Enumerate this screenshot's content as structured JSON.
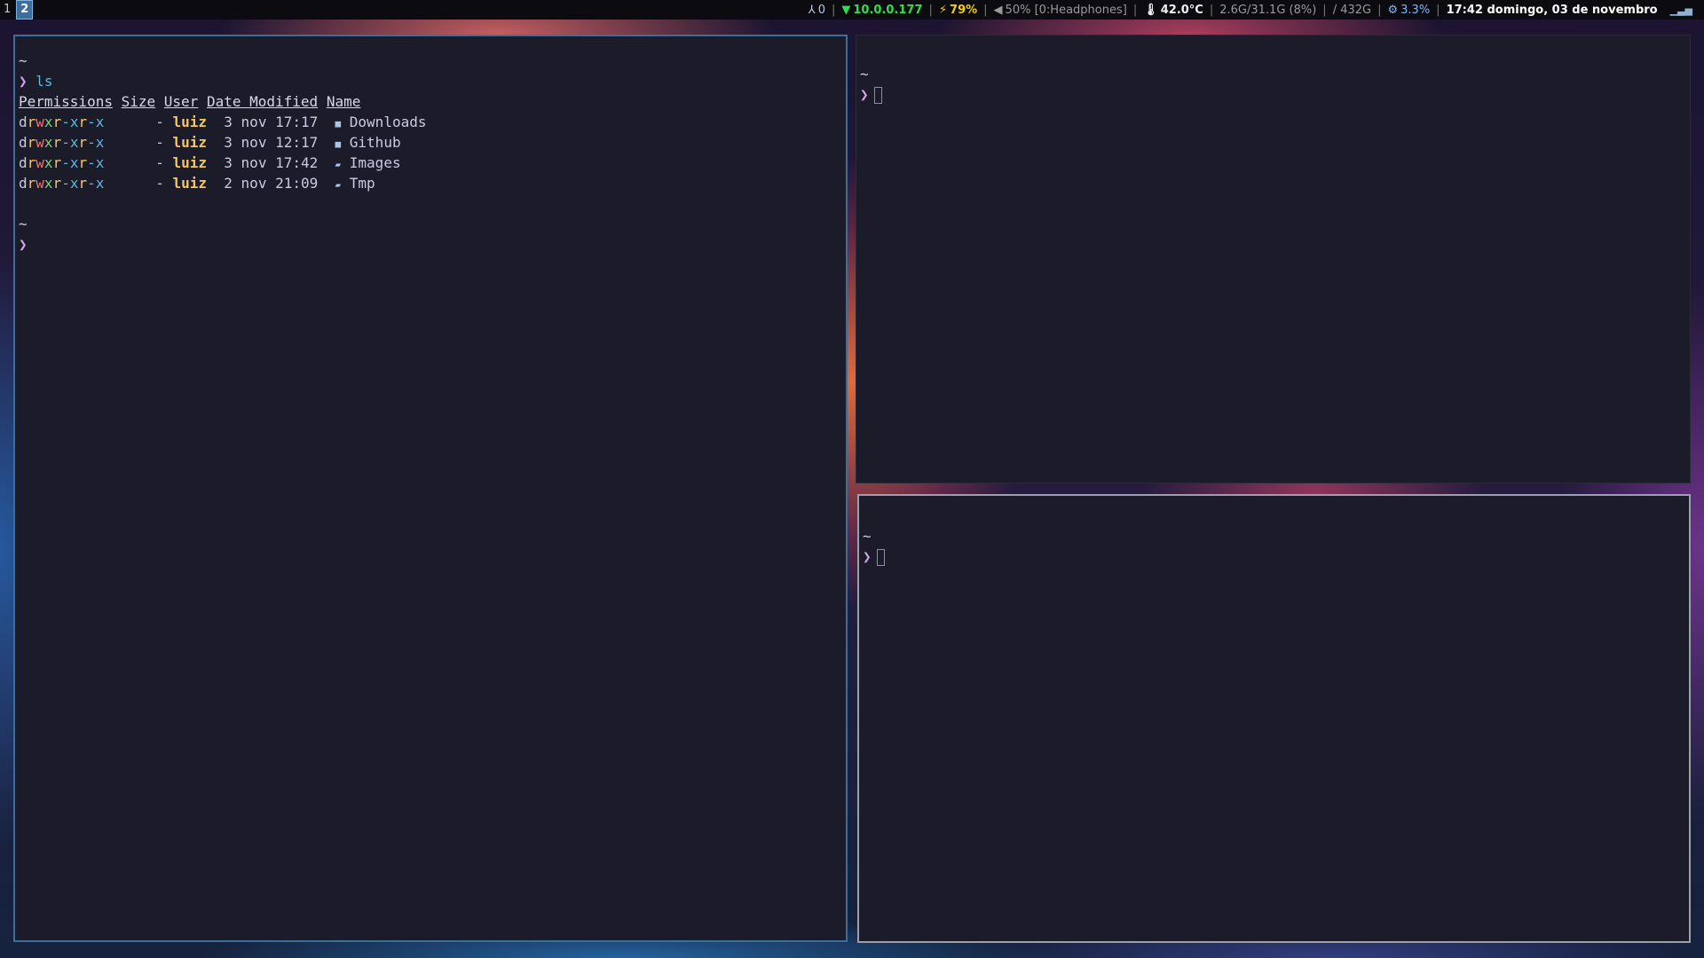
{
  "workspaces": [
    {
      "label": "1",
      "active": false
    },
    {
      "label": "2",
      "active": true
    }
  ],
  "status": {
    "user_icon": "person-icon",
    "user_count": "0",
    "net_icon": "wifi-icon",
    "network": "10.0.0.177",
    "bat_icon": "battery-charging-icon",
    "battery": "79%",
    "vol_icon": "speaker-icon",
    "volume": "50% [0:Headphones]",
    "temp_icon": "thermometer-icon",
    "temperature": "42.0°C",
    "memory": "2.6G/31.1G (8%)",
    "disk": "/ 432G",
    "cpu_icon": "cpu-icon",
    "cpu": "3.3%",
    "clock": "17:42 domingo, 03 de novembro",
    "signal_icon": "signal-bars-icon"
  },
  "left_terminal": {
    "tilde": "~",
    "prompt": "❯",
    "command": "ls",
    "headers": [
      "Permissions",
      "Size",
      "User",
      "Date Modified",
      "Name"
    ],
    "rows": [
      {
        "size": "-",
        "user": "luiz",
        "date": "3 nov 17:17",
        "name": "Downloads",
        "icon": "folder-icon"
      },
      {
        "size": "-",
        "user": "luiz",
        "date": "3 nov 12:17",
        "name": "Github",
        "icon": "folder-icon"
      },
      {
        "size": "-",
        "user": "luiz",
        "date": "3 nov 17:42",
        "name": "Images",
        "icon": "folder-open-icon"
      },
      {
        "size": "-",
        "user": "luiz",
        "date": "2 nov 21:09",
        "name": "Tmp",
        "icon": "folder-open-icon"
      }
    ],
    "perm_parts": [
      "d",
      "r",
      "w",
      "x",
      "r",
      "-",
      "x",
      "r",
      "-",
      "x"
    ],
    "tilde2": "~",
    "prompt2": "❯"
  },
  "right_top_terminal": {
    "tilde": "~",
    "prompt": "❯"
  },
  "right_bottom_terminal": {
    "tilde": "~",
    "prompt": "❯"
  },
  "colors": {
    "terminal_bg": "#1b1b29",
    "active_border": "#3b6f9a",
    "prompt": "#d8a0f0",
    "user": "#f4c760",
    "network": "#2fe04a",
    "battery": "#f5d000"
  }
}
